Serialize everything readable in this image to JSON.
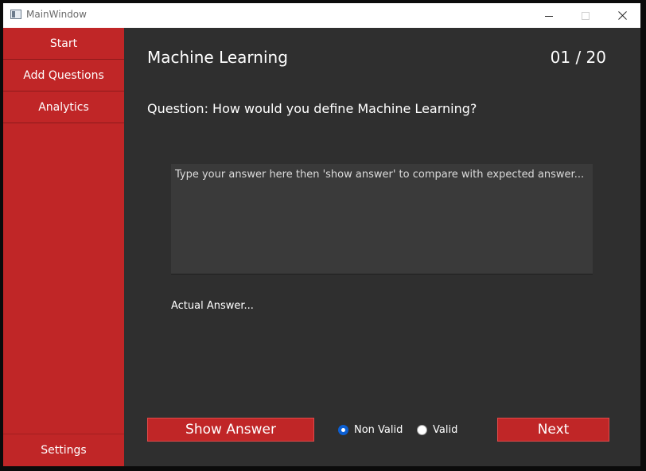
{
  "window": {
    "title": "MainWindow"
  },
  "sidebar": {
    "items": [
      {
        "label": "Start"
      },
      {
        "label": "Add Questions"
      },
      {
        "label": "Analytics"
      }
    ],
    "settings_label": "Settings"
  },
  "main": {
    "title": "Machine Learning",
    "counter": "01 / 20",
    "question": "Question: How would you define Machine Learning?",
    "answer_placeholder": "Type your answer here then 'show answer' to compare with expected answer...",
    "actual_answer": "Actual Answer...",
    "show_answer_label": "Show Answer",
    "next_label": "Next",
    "radios": [
      {
        "label": "Non Valid",
        "checked": true
      },
      {
        "label": "Valid",
        "checked": false
      }
    ]
  },
  "colors": {
    "accent": "#c02627",
    "background": "#2f2f2f",
    "radio_checked": "#0b5fd3"
  },
  "icons": [
    "window-app-icon",
    "minimize-icon",
    "maximize-icon",
    "close-icon"
  ]
}
